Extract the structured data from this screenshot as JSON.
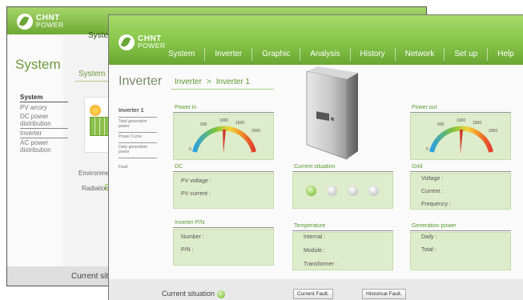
{
  "logo": {
    "line1": "CHNT",
    "line2": "POWER"
  },
  "back_window": {
    "nav_label": "System",
    "page_title": "System",
    "breadcrumb": "System",
    "sidebar": [
      "System",
      "PV arrory",
      "DC power distribution",
      "Inverter",
      "AC power distribution"
    ],
    "environment_label": "Environment",
    "radiation_label": "Radiation",
    "footer_status": "Current situ"
  },
  "nav": {
    "tabs": [
      "System",
      "Inverter",
      "Graphic",
      "Analysis",
      "History",
      "Network",
      "Set up",
      "Help"
    ]
  },
  "page": {
    "title": "Inverter",
    "breadcrumb": [
      "Inverter",
      ">",
      "Inverter 1"
    ]
  },
  "sidebar": {
    "items": [
      "Inverter 1",
      "Total generation power",
      "Power Curve",
      "Daily generation power",
      "Fault"
    ]
  },
  "power_in": {
    "label": "Power in",
    "ticks": [
      "0",
      "500",
      "1000",
      "1500",
      "2000"
    ]
  },
  "power_out": {
    "label": "Power out",
    "ticks": [
      "0",
      "500",
      "1000",
      "1500",
      "2000"
    ]
  },
  "dc": {
    "label": "DC",
    "pv_voltage": "PV voltage :",
    "pv_current": "PV current :"
  },
  "current_situation": {
    "label": "Current situation"
  },
  "grid": {
    "label": "Grid",
    "voltage": "Voltage :",
    "current": "Current :",
    "frequency": "Frequency :"
  },
  "inverter_pn": {
    "label": "Inverter P/N",
    "number": "Number :",
    "pn": "P/N :"
  },
  "temperature": {
    "label": "Temperature",
    "internal": "Internal :",
    "module": "Module :",
    "transformer": "Transformer :"
  },
  "generation_power": {
    "label": "Generation power",
    "daily": "Daily :",
    "total": "Total :"
  },
  "footer": {
    "status_label": "Current situation",
    "current_fault_button": "Current Fault.",
    "historical_fault_button": "Historical Fault."
  },
  "colors": {
    "accent": "#86c548",
    "accent_dark": "#6aa633",
    "panel": "#ddecca",
    "title_green": "#5a9a2f"
  }
}
